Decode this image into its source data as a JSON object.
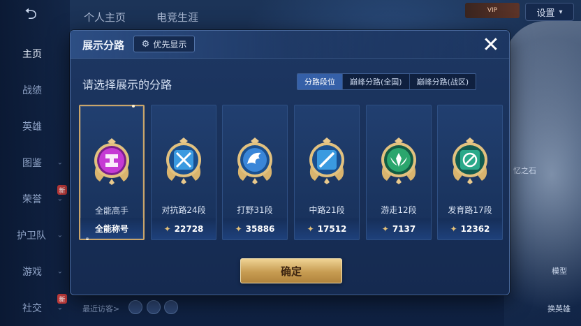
{
  "sidebar": {
    "back_icon": "back-arrow-icon",
    "items": [
      {
        "label": "主页",
        "active": true
      },
      {
        "label": "战绩"
      },
      {
        "label": "英雄"
      },
      {
        "label": "图鉴",
        "has_arrow": true
      },
      {
        "label": "荣誉",
        "has_arrow": true,
        "badge": "新"
      },
      {
        "label": "护卫队",
        "has_arrow": true
      },
      {
        "label": "游戏",
        "has_arrow": true
      },
      {
        "label": "社交",
        "has_arrow": true,
        "badge": "新"
      }
    ]
  },
  "top": {
    "tabs": [
      "个人主页",
      "电竞生涯"
    ],
    "settings_label": "设置",
    "vip_text": "VIP"
  },
  "bottom": {
    "visitors_label": "最近访客>",
    "right_labels": [
      "模型",
      "换英雄"
    ],
    "side_text": "忆之石"
  },
  "modal": {
    "title": "展示分路",
    "priority_button": "优先显示",
    "subtitle": "请选择展示的分路",
    "tabs": [
      {
        "label": "分路段位",
        "active": true
      },
      {
        "label": "巅峰分路(全国)"
      },
      {
        "label": "巅峰分路(战区)"
      }
    ],
    "cards": [
      {
        "name": "全能高手",
        "footer": "全能称号",
        "selected": true,
        "medal_color": "#b62fc0",
        "icon": "all-round-icon"
      },
      {
        "name": "对抗路24段",
        "points": "22728",
        "medal_color": "#3a8fd6",
        "icon": "clash-lane-icon"
      },
      {
        "name": "打野31段",
        "points": "35886",
        "medal_color": "#3a7fd0",
        "icon": "jungle-icon"
      },
      {
        "name": "中路21段",
        "points": "17512",
        "medal_color": "#3a8fd6",
        "icon": "mid-lane-icon"
      },
      {
        "name": "游走12段",
        "points": "7137",
        "medal_color": "#2ba66d",
        "icon": "roam-icon"
      },
      {
        "name": "发育路17段",
        "points": "12362",
        "medal_color": "#2aa98a",
        "icon": "farm-lane-icon"
      }
    ],
    "confirm_label": "确定"
  }
}
